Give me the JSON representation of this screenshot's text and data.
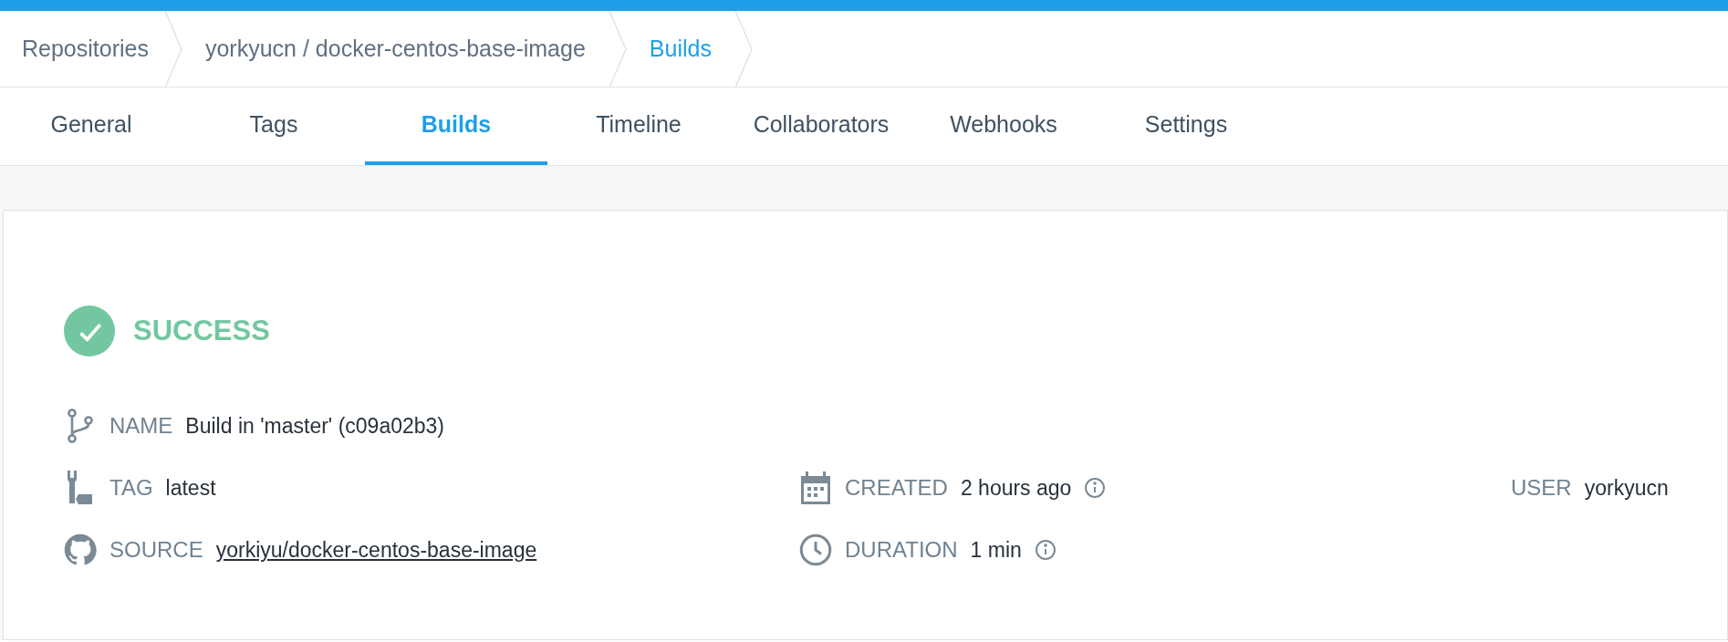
{
  "breadcrumbs": [
    {
      "label": "Repositories",
      "selected": false
    },
    {
      "label": "yorkyucn / docker-centos-base-image",
      "selected": false
    },
    {
      "label": "Builds",
      "selected": true
    }
  ],
  "tabs": [
    {
      "label": "General",
      "selected": false
    },
    {
      "label": "Tags",
      "selected": false
    },
    {
      "label": "Builds",
      "selected": true
    },
    {
      "label": "Timeline",
      "selected": false
    },
    {
      "label": "Collaborators",
      "selected": false
    },
    {
      "label": "Webhooks",
      "selected": false
    },
    {
      "label": "Settings",
      "selected": false
    }
  ],
  "build": {
    "status": {
      "kind": "success",
      "label": "SUCCESS"
    },
    "name": {
      "label": "NAME",
      "value": "Build in 'master' (c09a02b3)"
    },
    "tag": {
      "label": "TAG",
      "value": "latest"
    },
    "source": {
      "label": "SOURCE",
      "value": "yorkiyu/docker-centos-base-image"
    },
    "created": {
      "label": "CREATED",
      "value": "2 hours ago"
    },
    "duration": {
      "label": "DURATION",
      "value": "1 min"
    },
    "user": {
      "label": "USER",
      "value": "yorkyucn"
    }
  }
}
